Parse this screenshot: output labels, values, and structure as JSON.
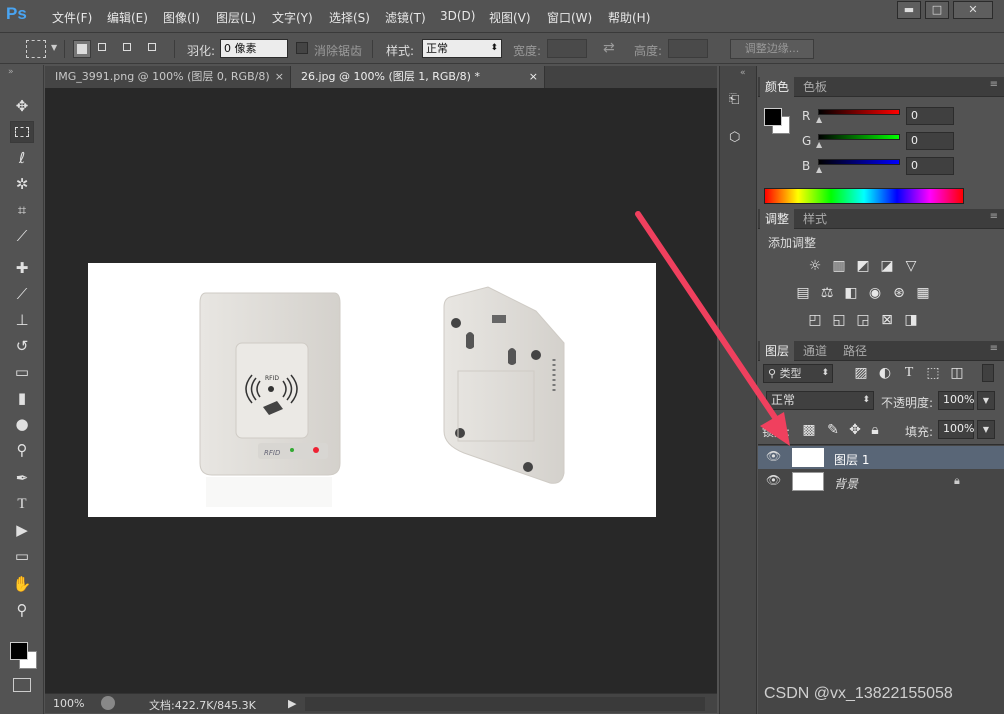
{
  "app": {
    "logo": "Ps"
  },
  "menu": [
    "文件(F)",
    "编辑(E)",
    "图像(I)",
    "图层(L)",
    "文字(Y)",
    "选择(S)",
    "滤镜(T)",
    "3D(D)",
    "视图(V)",
    "窗口(W)",
    "帮助(H)"
  ],
  "window_controls": {
    "minimize": "▬",
    "maximize": "□",
    "close": "✕"
  },
  "options": {
    "feather_label": "羽化:",
    "feather_value": "0 像素",
    "antialias_label": "消除锯齿",
    "style_label": "样式:",
    "style_value": "正常",
    "width_label": "宽度:",
    "height_label": "高度:",
    "refine_button": "调整边缘..."
  },
  "tabs": [
    {
      "label": "IMG_3991.png @ 100% (图层 0, RGB/8)",
      "close": "×"
    },
    {
      "label": "26.jpg @ 100% (图层 1, RGB/8) *",
      "close": "×"
    }
  ],
  "status": {
    "zoom": "100%",
    "doc": "文档:422.7K/845.3K",
    "arrow": "▶"
  },
  "color_panel": {
    "tabs": [
      "颜色",
      "色板"
    ],
    "channels": [
      {
        "label": "R",
        "value": "0"
      },
      {
        "label": "G",
        "value": "0"
      },
      {
        "label": "B",
        "value": "0"
      }
    ]
  },
  "adjust_panel": {
    "tabs": [
      "调整",
      "样式"
    ],
    "title": "添加调整"
  },
  "layers_panel": {
    "tabs": [
      "图层",
      "通道",
      "路径"
    ],
    "filter_kind": "类型",
    "blend_mode": "正常",
    "opacity_label": "不透明度:",
    "opacity_value": "100%",
    "lock_label": "锁定:",
    "fill_label": "填充:",
    "fill_value": "100%",
    "layers": [
      {
        "name": "图层 1",
        "selected": true
      },
      {
        "name": "背景",
        "selected": false,
        "locked": true
      }
    ]
  },
  "watermark": "CSDN @vx_13822155058",
  "colors": {
    "accent_arrow": "#f0405e",
    "ps_blue": "#49a4f2"
  }
}
